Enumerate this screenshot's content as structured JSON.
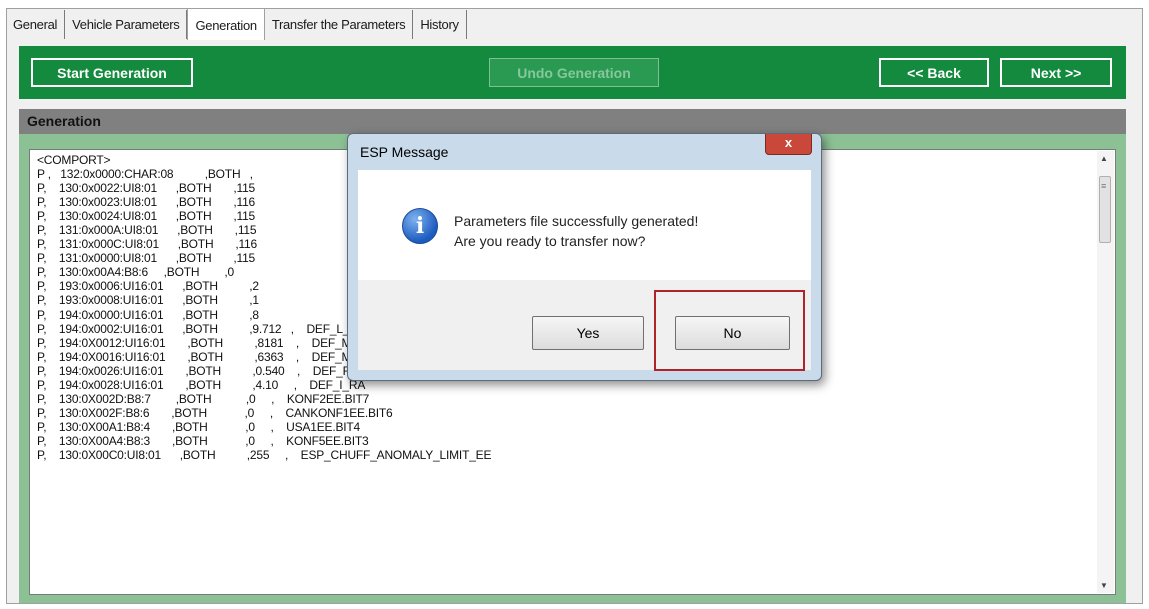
{
  "tabs": [
    "General",
    "Vehicle Parameters",
    "Generation",
    "Transfer the Parameters",
    "History"
  ],
  "active_tab": "Generation",
  "toolbar": {
    "start_label": "Start Generation",
    "undo_label": "Undo Generation",
    "back_label": "<< Back",
    "next_label": "Next >>"
  },
  "section_title": "Generation",
  "lines": [
    "<COMPORT>",
    "P ,   132:0x0000:CHAR:08          ,BOTH   ,",
    "P,    130:0x0022:UI8:01      ,BOTH       ,115",
    "P,    130:0x0023:UI8:01      ,BOTH       ,116",
    "P,    130:0x0024:UI8:01      ,BOTH       ,115",
    "P,    131:0x000A:UI8:01      ,BOTH       ,115",
    "P,    131:0x000C:UI8:01      ,BOTH       ,116",
    "P,    131:0x0000:UI8:01      ,BOTH       ,115",
    "P,    130:0x00A4:B8:6     ,BOTH        ,0",
    "P,    193:0x0006:UI16:01      ,BOTH          ,2",
    "P,    193:0x0008:UI16:01      ,BOTH          ,1",
    "P,    194:0x0000:UI16:01      ,BOTH          ,8",
    "P,    194:0x0002:UI16:01      ,BOTH          ,9.712   ,    DEF_L_WHEELBASE2",
    "P,    194:0X0012:UI16:01       ,BOTH          ,8181    ,    DEF_MAX_M_FA",
    "P,    194:0X0016:UI16:01       ,BOTH          ,6363    ,    DEF_MAX_M_RA2",
    "P,    194:0x0026:UI16:01       ,BOTH          ,0.540    ,    DEF_R_WH_RA",
    "P,    194:0x0028:UI16:01       ,BOTH          ,4.10     ,    DEF_I_RA",
    "P,    130:0X002D:B8:7        ,BOTH           ,0     ,    KONF2EE.BIT7",
    "P,    130:0X002F:B8:6       ,BOTH            ,0     ,    CANKONF1EE.BIT6",
    "P,    130:0X00A1:B8:4       ,BOTH            ,0     ,    USA1EE.BIT4",
    "P,    130:0X00A4:B8:3       ,BOTH            ,0     ,    KONF5EE.BIT3",
    "P,    130:0X00C0:UI8:01      ,BOTH          ,255     ,    ESP_CHUFF_ANOMALY_LIMIT_EE"
  ],
  "dialog": {
    "title": "ESP Message",
    "close_label": "x",
    "icon": "info-icon",
    "line1": "Parameters file successfully generated!",
    "line2": "Are you ready to transfer now?",
    "yes_label": "Yes",
    "no_label": "No"
  },
  "colors": {
    "toolbar_green": "#138a3e",
    "body_green": "#8cc195",
    "highlight_red": "#b0232a"
  }
}
